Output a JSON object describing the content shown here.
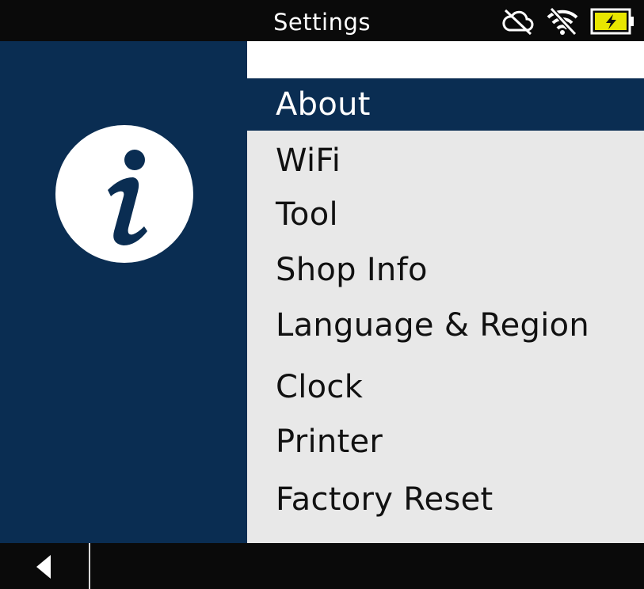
{
  "statusbar": {
    "title": "Settings",
    "icons": [
      "cloud-off-icon",
      "wifi-off-icon",
      "battery-charging-icon"
    ],
    "battery_color": "#e8e600"
  },
  "side_panel": {
    "icon": "info-icon",
    "background": "#0a2d52"
  },
  "menu": {
    "selected_index": 0,
    "items": [
      {
        "label": "About"
      },
      {
        "label": "WiFi"
      },
      {
        "label": "Tool"
      },
      {
        "label": "Shop Info"
      },
      {
        "label": "Language & Region"
      },
      {
        "label": "Clock"
      },
      {
        "label": "Printer"
      },
      {
        "label": "Factory Reset"
      }
    ]
  },
  "bottombar": {
    "back_icon": "back-arrow-icon"
  }
}
